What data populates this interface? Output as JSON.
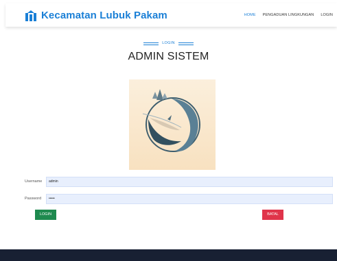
{
  "header": {
    "brand_name": "Kecamatan Lubuk Pakam",
    "nav": [
      {
        "label": "HOME",
        "active": true
      },
      {
        "label": "PENGADUAN LINGKUNGAN",
        "active": false
      },
      {
        "label": "LOGIN",
        "active": false
      }
    ],
    "brand_icon": "building-icon",
    "accent_color": "#1a7fd6"
  },
  "section": {
    "label": "LOGIN",
    "title": "ADMIN SISTEM"
  },
  "form": {
    "username_label": "Username",
    "username_value": "admin",
    "password_label": "Password",
    "password_value": "•••••",
    "login_label": "LOGIN",
    "cancel_label": "BATAL"
  },
  "colors": {
    "login_button": "#1e8a4f",
    "cancel_button": "#e0344a",
    "footer": "#182033",
    "input_bg": "#e8effd"
  }
}
